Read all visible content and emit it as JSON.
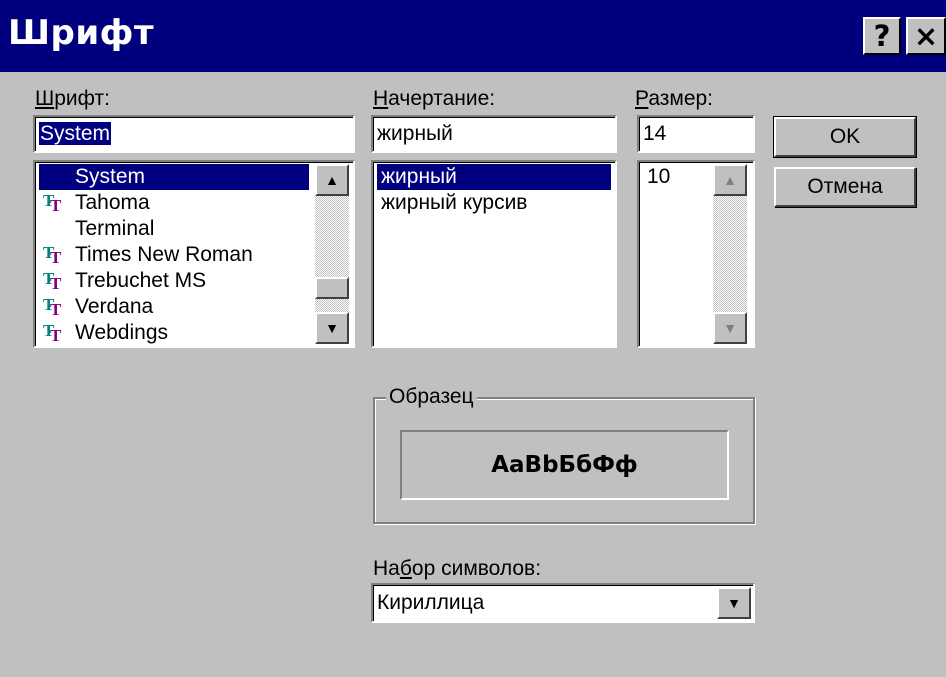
{
  "window": {
    "title": "Шрифт",
    "help_button": "?",
    "close_button": "×"
  },
  "font": {
    "label_mnemonic": "Ш",
    "label_rest": "рифт:",
    "value": "System",
    "items": [
      {
        "name": "System",
        "truetype": false,
        "selected": true
      },
      {
        "name": "Tahoma",
        "truetype": true,
        "selected": false
      },
      {
        "name": "Terminal",
        "truetype": false,
        "selected": false
      },
      {
        "name": "Times New Roman",
        "truetype": true,
        "selected": false
      },
      {
        "name": "Trebuchet MS",
        "truetype": true,
        "selected": false
      },
      {
        "name": "Verdana",
        "truetype": true,
        "selected": false
      },
      {
        "name": "Webdings",
        "truetype": true,
        "selected": false
      }
    ]
  },
  "style": {
    "label_mnemonic": "Н",
    "label_rest": "ачертание:",
    "value": "жирный",
    "items": [
      {
        "name": "жирный",
        "selected": true
      },
      {
        "name": "жирный курсив",
        "selected": false
      }
    ]
  },
  "size": {
    "label_mnemonic": "Р",
    "label_rest": "азмер:",
    "value": "14",
    "items": [
      {
        "name": "10",
        "selected": false
      }
    ]
  },
  "buttons": {
    "ok": "OK",
    "cancel": "Отмена"
  },
  "sample": {
    "label": "Образец",
    "text": "AaBbБбФф"
  },
  "charset": {
    "label_pre": "На",
    "label_mnemonic": "б",
    "label_post": "ор символов:",
    "value": "Кириллица"
  },
  "icons": {
    "truetype": "truetype-font-icon",
    "scroll_up": "▲",
    "scroll_down": "▼"
  }
}
